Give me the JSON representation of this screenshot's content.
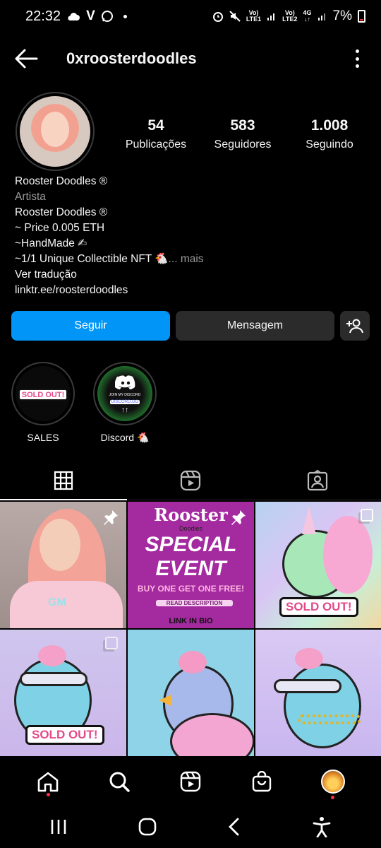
{
  "status_bar": {
    "time": "22:32",
    "sim1": "LTE1",
    "sim2": "LTE2",
    "net": "4G",
    "battery": "7%"
  },
  "header": {
    "username": "0xroosterdoodles"
  },
  "stats": [
    {
      "value": "54",
      "label": "Publicações"
    },
    {
      "value": "583",
      "label": "Seguidores"
    },
    {
      "value": "1.008",
      "label": "Seguindo"
    }
  ],
  "bio": {
    "name": "Rooster Doodles ®",
    "category": "Artista",
    "line1": "Rooster Doodles ®",
    "line2": "~ Price 0.005 ETH",
    "line3": "~HandMade ✍",
    "line4": "~1/1 Unique Collectible NFT 🐔",
    "more": "... mais",
    "translate": "Ver tradução",
    "link": "linktr.ee/roosterdoodles"
  },
  "buttons": {
    "follow": "Seguir",
    "message": "Mensagem"
  },
  "highlights": [
    {
      "label": "SALES",
      "tag": "SOLD OUT!"
    },
    {
      "label": "Discord 🐔",
      "text1": "JOIN MY DISCORD",
      "text2": "DISCORD.GG"
    }
  ],
  "posts": {
    "event": {
      "brand": "Rooster",
      "brand_sub": "Doodles",
      "title1": "SPECIAL",
      "title2": "EVENT",
      "offer": "BUY ONE GET ONE FREE!",
      "desc": "READ DESCRIPTION",
      "link": "LINK IN BIO"
    },
    "sold_out": "SOLD OUT!",
    "shirt_text": "GM"
  }
}
